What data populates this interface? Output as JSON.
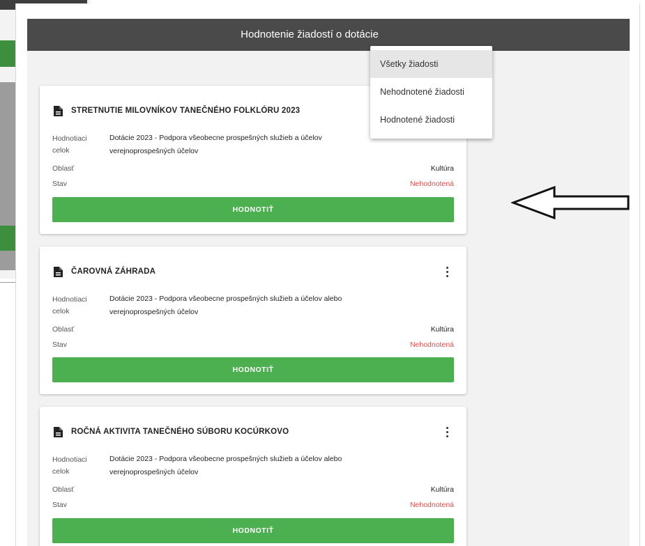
{
  "header": {
    "title": "Hodnotenie žiadostí o dotácie"
  },
  "filter_menu": {
    "items": [
      {
        "label": "Všetky žiadosti",
        "active": true
      },
      {
        "label": "Nehodnotené žiadosti",
        "active": false
      },
      {
        "label": "Hodnotené žiadosti",
        "active": false
      }
    ]
  },
  "labels": {
    "evaluation_unit_line1": "Hodnotiaci",
    "evaluation_unit_line2": "celok",
    "area": "Oblasť",
    "status": "Stav"
  },
  "cards": [
    {
      "title": "STRETNUTIE MILOVNÍKOV TANEČNÉHO FOLKLÓRU 2023",
      "unit_line1": "Dotácie 2023 - Podpora všeobecne prospešných služieb a účelov",
      "unit_line2": "verejnoprospešných účelov",
      "area": "Kultúra",
      "status": "Nehodnotená",
      "button": "HODNOTIŤ"
    },
    {
      "title": "ČAROVNÁ ZÁHRADA",
      "unit_line1": "Dotácie 2023 - Podpora všeobecne prospešných služieb a účelov alebo",
      "unit_line2": "verejnoprospešných účelov",
      "area": "Kultúra",
      "status": "Nehodnotená",
      "button": "HODNOTIŤ"
    },
    {
      "title": "ROČNÁ AKTIVITA TANEČNÉHO SÚBORU KOCÚRKOVO",
      "unit_line1": "Dotácie 2023 - Podpora všeobecne prospešných služieb a účelov alebo",
      "unit_line2": "verejnoprospešných účelov",
      "area": "Kultúra",
      "status": "Nehodnotená",
      "button": "HODNOTIŤ"
    }
  ],
  "colors": {
    "header_bg": "#4a4a4a",
    "button_green": "#4caf50",
    "status_red": "#e04b4b",
    "panel_bg": "#f2f2f2"
  }
}
